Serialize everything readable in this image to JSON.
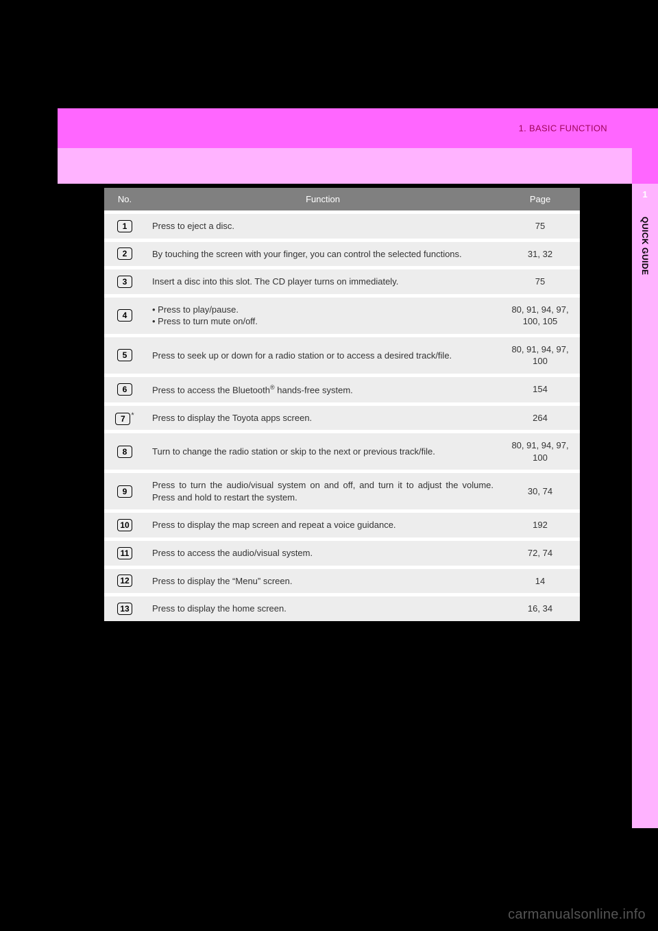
{
  "header": {
    "breadcrumb": "1. BASIC FUNCTION"
  },
  "side": {
    "chapter_number": "1",
    "label": "QUICK GUIDE"
  },
  "table": {
    "headers": {
      "no": "No.",
      "function": "Function",
      "page": "Page"
    },
    "rows": [
      {
        "num": "1",
        "star": "",
        "function": "Press to eject a disc.",
        "page": "75"
      },
      {
        "num": "2",
        "star": "",
        "function": "By touching the screen with your finger, you can control the selected functions.",
        "page": "31, 32"
      },
      {
        "num": "3",
        "star": "",
        "function": "Insert a disc into this slot. The CD player turns on immediately.",
        "page": "75"
      },
      {
        "num": "4",
        "star": "",
        "bullets": [
          "Press to play/pause.",
          "Press to turn mute on/off."
        ],
        "page": "80, 91, 94, 97, 100, 105"
      },
      {
        "num": "5",
        "star": "",
        "function": "Press to seek up or down for a radio station or to access a desired track/file.",
        "page": "80, 91, 94, 97, 100"
      },
      {
        "num": "6",
        "star": "",
        "function_html": "Press to access the Bluetooth® hands-free system.",
        "function_prefix": "Press to access the Bluetooth",
        "function_suffix": " hands-free system.",
        "page": "154"
      },
      {
        "num": "7",
        "star": "*",
        "function": "Press to display the Toyota apps screen.",
        "page": "264"
      },
      {
        "num": "8",
        "star": "",
        "function": "Turn to change the radio station or skip to the next or previous track/file.",
        "page": "80, 91, 94, 97, 100"
      },
      {
        "num": "9",
        "star": "",
        "function": "Press to turn the audio/visual system on and off, and turn it to adjust the volume. Press and hold to restart the system.",
        "page": "30, 74"
      },
      {
        "num": "10",
        "star": "",
        "function": "Press to display the map screen and repeat a voice guidance.",
        "page": "192"
      },
      {
        "num": "11",
        "star": "",
        "function": "Press to access the audio/visual system.",
        "page": "72, 74"
      },
      {
        "num": "12",
        "star": "",
        "function": "Press to display the “Menu” screen.",
        "page": "14"
      },
      {
        "num": "13",
        "star": "",
        "function": "Press to display the home screen.",
        "page": "16, 34"
      }
    ]
  },
  "watermark": "carmanualsonline.info"
}
